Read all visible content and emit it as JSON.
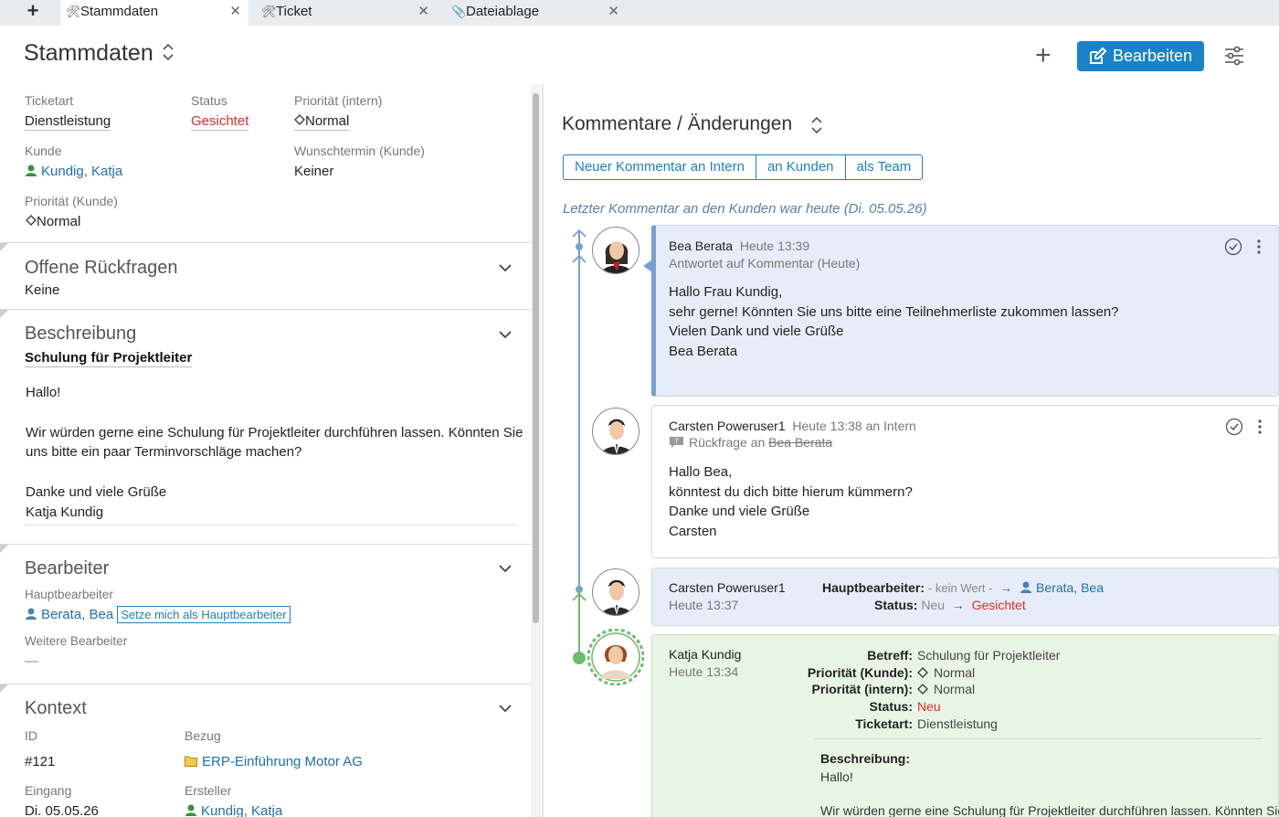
{
  "tabs": [
    {
      "label": "Stammdaten",
      "icon": "tools-icon",
      "active": true
    },
    {
      "label": "Ticket",
      "icon": "tools-icon",
      "active": false
    },
    {
      "label": "Dateiablage",
      "icon": "paperclip-icon",
      "active": false
    }
  ],
  "header": {
    "title": "Stammdaten",
    "edit_label": "Bearbeiten"
  },
  "stammdaten": {
    "ticketart_label": "Ticketart",
    "ticketart": "Dienstleistung",
    "status_label": "Status",
    "status": "Gesichtet",
    "prio_intern_label": "Priorität (intern)",
    "prio_intern": "Normal",
    "kunde_label": "Kunde",
    "kunde": "Kundig, Katja",
    "wunschtermin_label": "Wunschtermin (Kunde)",
    "wunschtermin": "Keiner",
    "prio_kunde_label": "Priorität (Kunde)",
    "prio_kunde": "Normal"
  },
  "rueckfragen": {
    "title": "Offene Rückfragen",
    "value": "Keine"
  },
  "beschreibung": {
    "title": "Beschreibung",
    "subject": "Schulung für Projektleiter",
    "lines": [
      "Hallo!",
      "",
      "Wir würden gerne eine Schulung für Projektleiter durchführen lassen. Könnten Sie",
      "uns bitte ein paar Terminvorschläge machen?",
      "",
      "Danke und viele Grüße",
      "Katja Kundig"
    ]
  },
  "bearbeiter": {
    "title": "Bearbeiter",
    "haupt_label": "Hauptbearbeiter",
    "haupt": "Berata, Bea",
    "setze_label": "Setze mich als Hauptbearbeiter",
    "weitere_label": "Weitere Bearbeiter",
    "weitere": "—"
  },
  "kontext": {
    "title": "Kontext",
    "id_label": "ID",
    "id": "#121",
    "bezug_label": "Bezug",
    "bezug": "ERP-Einführung Motor AG",
    "eingang_label": "Eingang",
    "eingang": "Di. 05.05.26",
    "ersteller_label": "Ersteller",
    "ersteller": "Kundig, Katja"
  },
  "comments": {
    "title": "Kommentare / Änderungen",
    "buttons": [
      "Neuer Kommentar an Intern",
      "an Kunden",
      "als Team"
    ],
    "last_comment": "Letzter Kommentar an den Kunden war heute (Di. 05.05.26)",
    "items": [
      {
        "author": "Bea Berata",
        "time": "Heute 13:39",
        "sub": "Antwortet auf Kommentar (Heute)",
        "body": [
          "Hallo Frau Kundig,",
          "sehr gerne! Könnten Sie uns bitte eine Teilnehmerliste zukommen lassen?",
          "Vielen Dank und viele Grüße",
          "Bea Berata"
        ]
      },
      {
        "author": "Carsten Poweruser1",
        "time": "Heute 13:38 an Intern",
        "sub_prefix": "Rückfrage an",
        "sub_target": "Bea Berata",
        "body": [
          "Hallo Bea,",
          "könntest du dich bitte hierum kümmern?",
          "Danke und viele Grüße",
          "Carsten"
        ]
      },
      {
        "author": "Carsten Poweruser1",
        "time": "Heute 13:37",
        "haupt_key": "Hauptbearbeiter:",
        "haupt_from": "- kein Wert -",
        "haupt_to": "Berata, Bea",
        "status_key": "Status:",
        "status_from": "Neu",
        "status_to": "Gesichtet"
      },
      {
        "author": "Katja Kundig",
        "time": "Heute 13:34",
        "fields": [
          {
            "key": "Betreff:",
            "value": "Schulung für Projektleiter"
          },
          {
            "key": "Priorität (Kunde):",
            "value": "Normal"
          },
          {
            "key": "Priorität (intern):",
            "value": "Normal"
          },
          {
            "key": "Status:",
            "value": "Neu"
          },
          {
            "key": "Ticketart:",
            "value": "Dienstleistung"
          }
        ],
        "desc_label": "Beschreibung:",
        "desc_line1": "Hallo!",
        "desc_line2": "Wir würden gerne eine Schulung für Projektleiter durchführen lassen. Könnten Sie"
      }
    ]
  },
  "colors": {
    "accent": "#1a82c9",
    "status_red": "#e02b2b",
    "timeline_blue": "#7a9ed6",
    "timeline_green": "#6cbb6c"
  }
}
